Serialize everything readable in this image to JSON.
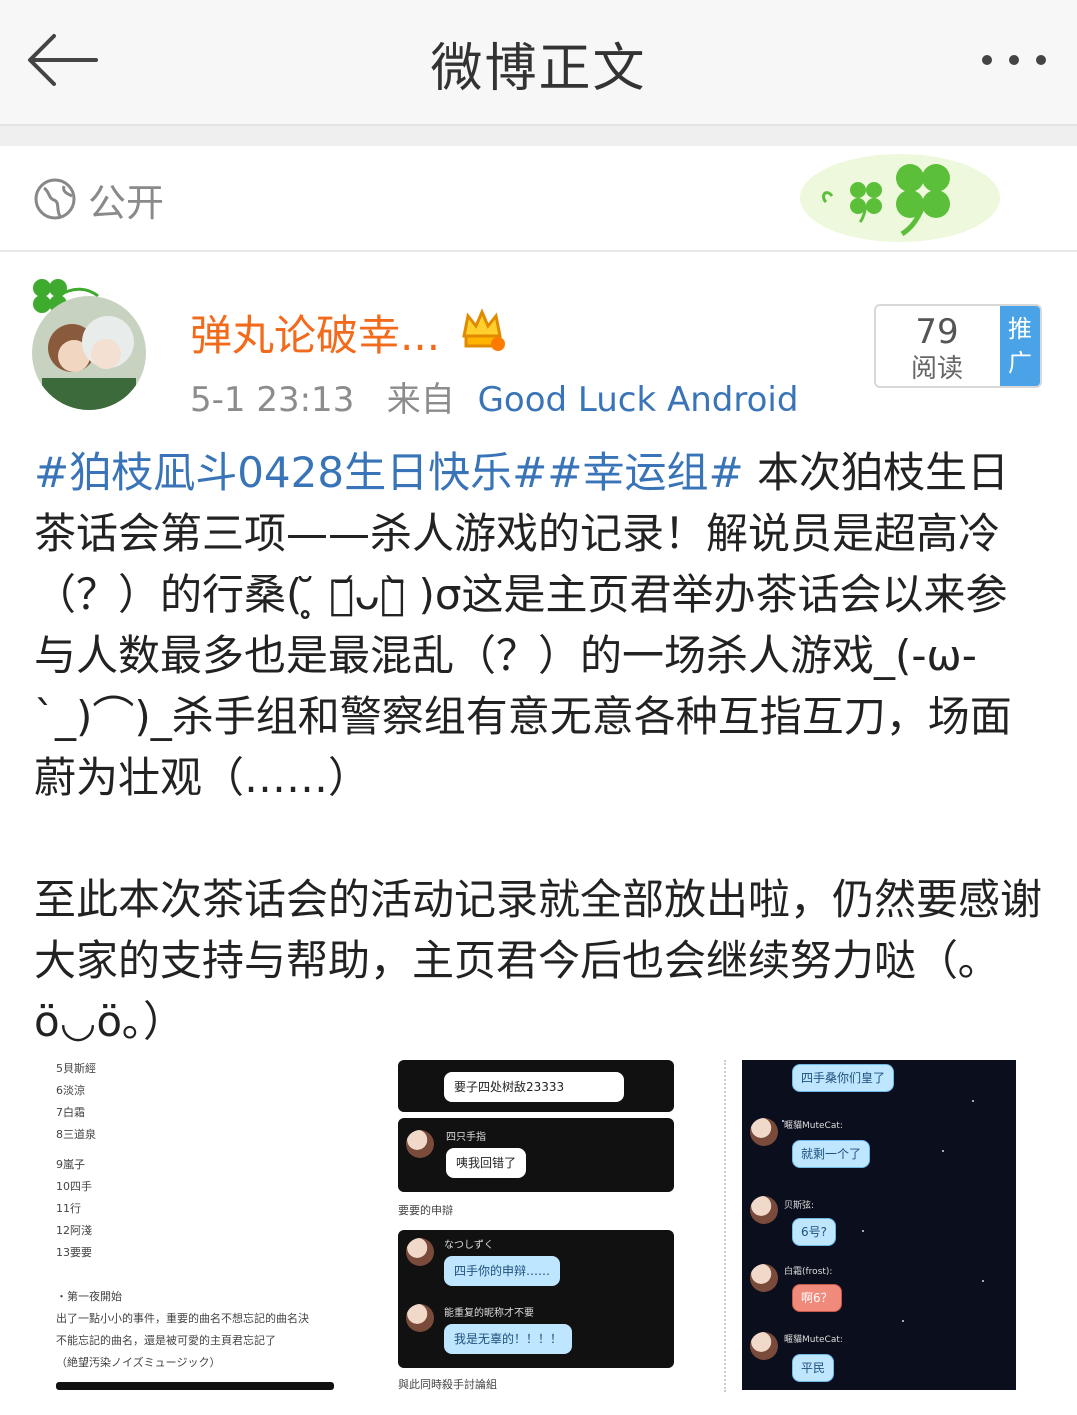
{
  "header": {
    "title": "微博正文"
  },
  "visibility": {
    "label": "公开"
  },
  "author": {
    "name": "弹丸论破幸...",
    "time": "5-1 23:13",
    "from_prefix": "来自",
    "source": "Good Luck Android"
  },
  "reads": {
    "count": "79",
    "label": "阅读",
    "promote": "推广"
  },
  "post": {
    "tags": "#狛枝凪斗0428生日快乐##幸运组#",
    "body1": " 本次狛枝生日茶话会第三项——杀人游戏的记录！解说员是超高冷（？）的行桑(  ̥̆ ･᷄ᴗ･᷅ )σ这是主页君举办茶话会以来参与人数最多也是最混乱（？）的一场杀人游戏_(-ω-`_)⌒)_杀手组和警察组有意无意各种互指互刀，场面蔚为壮观（……）",
    "body2": "至此本次茶话会的活动记录就全部放出啦，仍然要感谢大家的支持与帮助，主页君今后也会继续努力哒（｡ö◡ö｡）"
  },
  "image1": {
    "lines": [
      "5貝斯經",
      "6淡涼",
      "7白霜",
      "8三道泉",
      "9嵐子",
      "10四手",
      "11行",
      "12阿淺",
      "13要要",
      "・第一夜開始",
      "出了一點小小的事件，重要的曲名不想忘記的曲名決",
      "不能忘記的曲名，還是被可愛的主頁君忘記了",
      "（絶望汚染ノイズミュージック）"
    ]
  },
  "image2": {
    "msg1": "要子四处树敌23333",
    "name1": "四只手指",
    "msg2": "咦我回错了",
    "caption1": "要要的申辯",
    "name2": "なつしずく",
    "msg3": "四手你的申辩……",
    "name3": "能重复的昵称才不要",
    "msg4": "我是无辜的！！！！",
    "caption2": "與此同時殺手討論組"
  },
  "image3": {
    "msg1": "四手桑你们皇了",
    "name1": "暱貓MuteCat:",
    "msg2": "就剩一个了",
    "name2": "贝斯弦:",
    "msg3": "6号?",
    "name3": "白霜(frost):",
    "msg4": "啊6？",
    "name4": "暱貓MuteCat:",
    "msg5": "平民"
  }
}
